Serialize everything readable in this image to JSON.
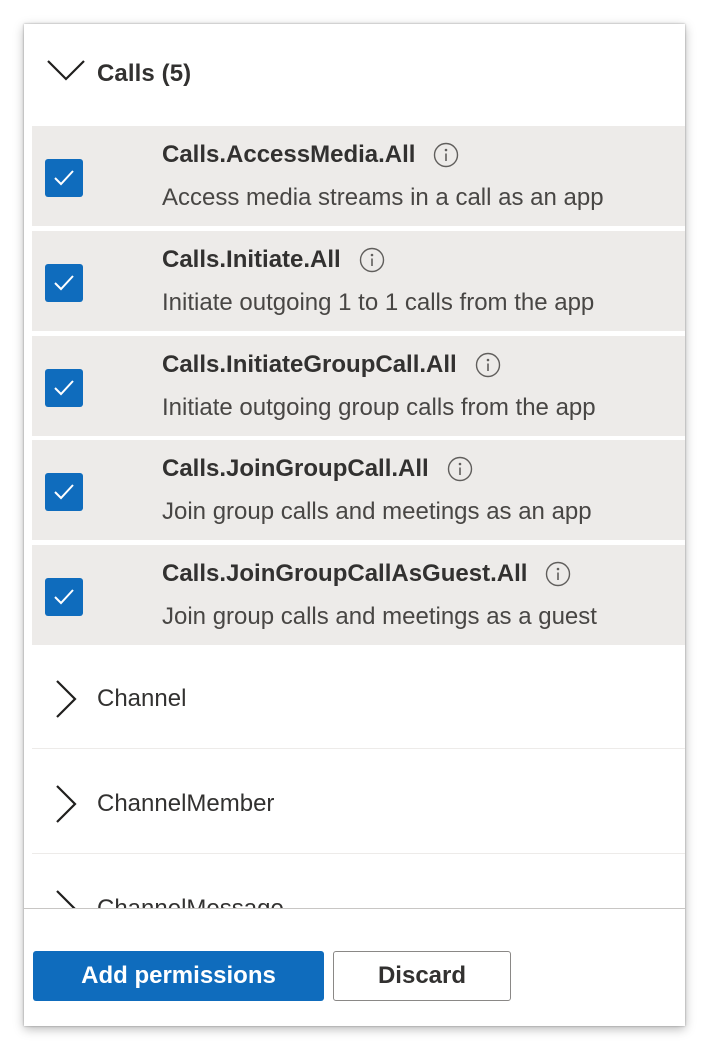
{
  "group": {
    "title": "Calls (5)",
    "icon": "chevron-down-icon"
  },
  "permissions": [
    {
      "name": "Calls.AccessMedia.All",
      "description": "Access media streams in a call as an app",
      "checked": true
    },
    {
      "name": "Calls.Initiate.All",
      "description": "Initiate outgoing 1 to 1 calls from the app",
      "checked": true
    },
    {
      "name": "Calls.InitiateGroupCall.All",
      "description": "Initiate outgoing group calls from the app",
      "checked": true
    },
    {
      "name": "Calls.JoinGroupCall.All",
      "description": "Join group calls and meetings as an app",
      "checked": true
    },
    {
      "name": "Calls.JoinGroupCallAsGuest.All",
      "description": "Join group calls and meetings as a guest",
      "checked": true
    }
  ],
  "categories": [
    {
      "label": "Channel",
      "icon": "chevron-right-icon"
    },
    {
      "label": "ChannelMember",
      "icon": "chevron-right-icon"
    },
    {
      "label": "ChannelMessage",
      "icon": "chevron-right-icon"
    }
  ],
  "footer": {
    "add_label": "Add permissions",
    "discard_label": "Discard"
  },
  "colors": {
    "accent": "#0f6cbd",
    "row_background": "#edebe9",
    "text": "#323130"
  }
}
